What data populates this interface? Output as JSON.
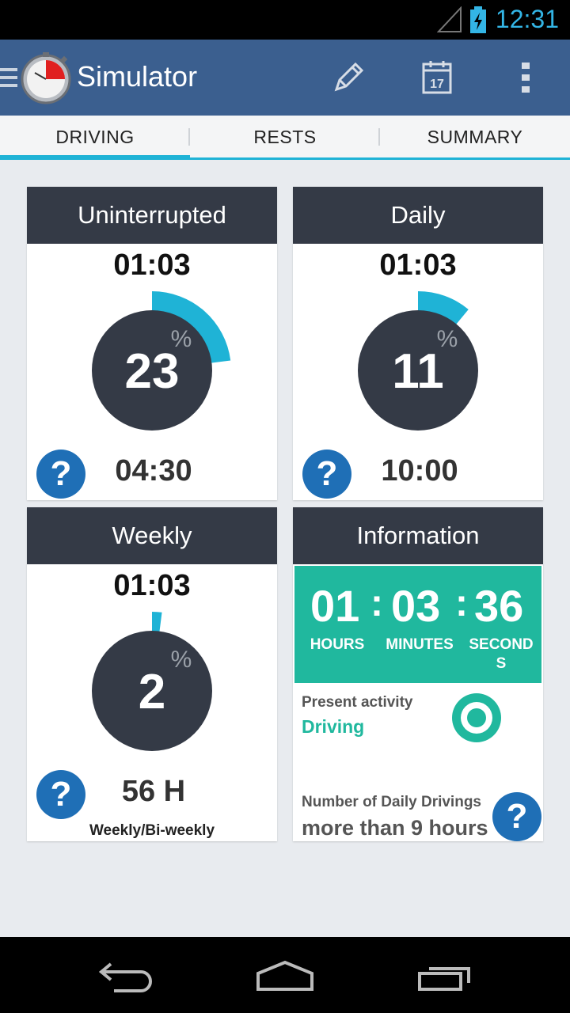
{
  "status": {
    "time": "12:31"
  },
  "app": {
    "title": "Simulator"
  },
  "tabs": [
    {
      "label": "DRIVING",
      "active": true
    },
    {
      "label": "RESTS",
      "active": false
    },
    {
      "label": "SUMMARY",
      "active": false
    }
  ],
  "cards": {
    "uninterrupted": {
      "title": "Uninterrupted",
      "elapsed": "01:03",
      "percent": "23",
      "percent_symbol": "%",
      "limit": "04:30",
      "fraction": 0.23
    },
    "daily": {
      "title": "Daily",
      "elapsed": "01:03",
      "percent": "11",
      "percent_symbol": "%",
      "limit": "10:00",
      "fraction": 0.11
    },
    "weekly": {
      "title": "Weekly",
      "elapsed": "01:03",
      "percent": "2",
      "percent_symbol": "%",
      "limit": "56 H",
      "sublabel": "Weekly/Bi-weekly",
      "fraction": 0.02
    },
    "information": {
      "title": "Information",
      "hours": "01",
      "minutes": "03",
      "seconds": "36",
      "hours_label": "HOURS",
      "minutes_label": "MINUTES",
      "seconds_label": "SECOND\nS",
      "present_activity_label": "Present activity",
      "present_activity_value": "Driving",
      "daily_drivings_label": "Number of Daily Drivings",
      "daily_drivings_value": "more than 9 hours"
    }
  },
  "colors": {
    "accent": "#1fb3d6",
    "appbar": "#3b5f8f",
    "card_head": "#343a46",
    "timer": "#20b89e",
    "help": "#1f6fb6"
  },
  "icons": [
    "hamburger-icon",
    "app-logo-icon",
    "pencil-icon",
    "calendar-icon",
    "overflow-menu-icon",
    "help-icon",
    "activity-ring-icon",
    "back-icon",
    "home-icon",
    "recents-icon"
  ]
}
